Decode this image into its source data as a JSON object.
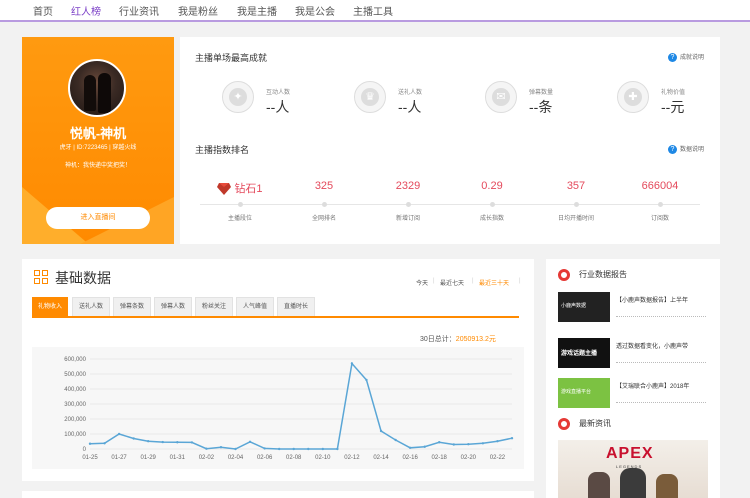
{
  "nav": {
    "items": [
      {
        "label": "首页",
        "active": false
      },
      {
        "label": "红人榜",
        "active": true
      },
      {
        "label": "行业资讯",
        "active": false
      },
      {
        "label": "我是粉丝",
        "active": false
      },
      {
        "label": "我是主播",
        "active": false
      },
      {
        "label": "我是公会",
        "active": false
      },
      {
        "label": "主播工具",
        "active": false
      }
    ]
  },
  "profile": {
    "name": "悦帆-神机",
    "meta": "虎牙 | ID:7223465 | 穿越火线",
    "slogan": "神机：我快递中奖把奖！",
    "enter_label": "进入直播间"
  },
  "achievements": {
    "title": "主播单场最高成就",
    "help_label": "成就说明",
    "items": [
      {
        "icon": "medal-icon",
        "label": "互动人数",
        "value": "--人"
      },
      {
        "icon": "crown-icon",
        "label": "送礼人数",
        "value": "--人"
      },
      {
        "icon": "danmaku-icon",
        "label": "弹幕数量",
        "value": "--条"
      },
      {
        "icon": "gift-icon",
        "label": "礼物价值",
        "value": "--元"
      }
    ]
  },
  "ranking": {
    "title": "主播指数排名",
    "help_label": "数据说明",
    "items": [
      {
        "value": "钻石1",
        "label": "主播段位",
        "icon": "diamond-icon"
      },
      {
        "value": "325",
        "label": "全网排名"
      },
      {
        "value": "2329",
        "label": "新增订阅"
      },
      {
        "value": "0.29",
        "label": "成长指数"
      },
      {
        "value": "357",
        "label": "日均开播时间"
      },
      {
        "value": "666004",
        "label": "订阅数"
      }
    ]
  },
  "basic": {
    "title": "基础数据",
    "ranges": [
      {
        "label": "今天",
        "active": false
      },
      {
        "label": "最近七天",
        "active": false
      },
      {
        "label": "最近三十天",
        "active": true
      }
    ],
    "tabs": [
      {
        "label": "礼物收入",
        "active": true
      },
      {
        "label": "送礼人数",
        "active": false
      },
      {
        "label": "弹幕条数",
        "active": false
      },
      {
        "label": "弹幕人数",
        "active": false
      },
      {
        "label": "粉丝关注",
        "active": false
      },
      {
        "label": "人气峰值",
        "active": false
      },
      {
        "label": "直播时长",
        "active": false
      }
    ],
    "total_label": "30日总计：",
    "total_value": "2050913.2元"
  },
  "chart_data": {
    "type": "line",
    "title": "",
    "xlabel": "",
    "ylabel": "",
    "x": [
      "01-25",
      "01-26",
      "01-27",
      "01-28",
      "01-29",
      "01-30",
      "01-31",
      "02-01",
      "02-02",
      "02-03",
      "02-04",
      "02-05",
      "02-06",
      "02-07",
      "02-08",
      "02-09",
      "02-10",
      "02-11",
      "02-12",
      "02-13",
      "02-14",
      "02-15",
      "02-16",
      "02-17",
      "02-18",
      "02-19",
      "02-20",
      "02-21",
      "02-22",
      "02-23"
    ],
    "x_tick_labels": [
      "01-25",
      "01-27",
      "01-29",
      "01-31",
      "02-02",
      "02-04",
      "02-06",
      "02-08",
      "02-10",
      "02-12",
      "02-14",
      "02-16",
      "02-18",
      "02-20",
      "02-22"
    ],
    "series": [
      {
        "values": [
          35000,
          38000,
          100000,
          70000,
          52000,
          46000,
          45000,
          44000,
          2000,
          12000,
          0,
          48000,
          4000,
          0,
          0,
          0,
          0,
          0,
          570000,
          460000,
          120000,
          60000,
          8000,
          15000,
          45000,
          30000,
          32000,
          38000,
          52000,
          72000
        ]
      }
    ],
    "ylim": [
      0,
      600000
    ],
    "y_ticks": [
      "0",
      "100,000",
      "200,000",
      "300,000",
      "400,000",
      "500,000",
      "600,000"
    ],
    "grid": true,
    "color": "#5aa6d6"
  },
  "industry": {
    "title": "行业数据报告",
    "items": [
      {
        "thumb": "小鹿声数据",
        "text": "【小鹿声数据报告】上半年",
        "color": "#222222"
      },
      {
        "thumb": "游戏话题主播",
        "text": "透过数据看变化，小鹿声带",
        "color": "#111111"
      },
      {
        "thumb": "游戏直播平台",
        "text": "【艾瑞联合小鹿声】2018年",
        "color": "#7cc242"
      }
    ]
  },
  "news": {
    "title": "最新资讯",
    "apex_logo": "APEX",
    "apex_sub": "LEGENDS"
  }
}
